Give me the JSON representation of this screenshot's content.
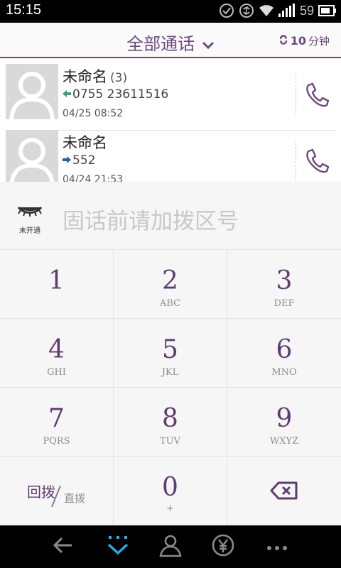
{
  "status": {
    "time": "15:15",
    "battery": "59"
  },
  "header": {
    "title": "全部通话",
    "minutes_value": "10",
    "minutes_unit": "分钟"
  },
  "calls": [
    {
      "name": "未命名",
      "count": "(3)",
      "number": "0755 23611516",
      "direction": "incoming",
      "time": "04/25  08:52"
    },
    {
      "name": "未命名",
      "count": "",
      "number": "552",
      "direction": "outgoing",
      "time": "04/24  21:53"
    }
  ],
  "dialer": {
    "status_label": "未开通",
    "placeholder": "固话前请加拨区号",
    "keys": [
      {
        "digit": "1",
        "letters": ""
      },
      {
        "digit": "2",
        "letters": "ABC"
      },
      {
        "digit": "3",
        "letters": "DEF"
      },
      {
        "digit": "4",
        "letters": "GHI"
      },
      {
        "digit": "5",
        "letters": "JKL"
      },
      {
        "digit": "6",
        "letters": "MNO"
      },
      {
        "digit": "7",
        "letters": "PQRS"
      },
      {
        "digit": "8",
        "letters": "TUV"
      },
      {
        "digit": "9",
        "letters": "WXYZ"
      },
      {
        "digit": "0",
        "letters": "+"
      }
    ],
    "redial_label": "回拨",
    "direct_label": "直拨"
  },
  "icons": {
    "status": [
      "check-circle-icon",
      "sync-icon",
      "wifi-icon",
      "signal-icon",
      "battery-icon"
    ],
    "nav": [
      "back-icon",
      "dialpad-icon",
      "contacts-icon",
      "yuan-icon",
      "more-icon"
    ]
  },
  "colors": {
    "accent": "#6d4a7e",
    "incoming": "#3a9a8a",
    "outgoing": "#2a5ea8"
  }
}
